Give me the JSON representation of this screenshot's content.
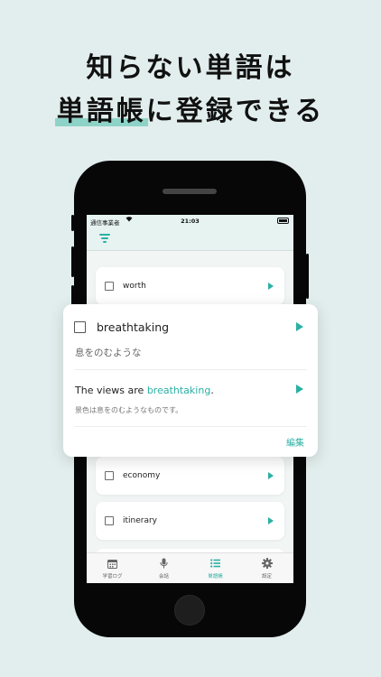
{
  "headline": {
    "line1": "知らない単語は",
    "line2_highlight": "単語帳",
    "line2_rest": "に登録できる"
  },
  "status_bar": {
    "carrier": "通信事業者",
    "wifi_icon": "wifi-icon",
    "time": "21:03",
    "battery_icon": "battery-icon"
  },
  "nav_bar": {
    "filter_icon": "filter-icon"
  },
  "words": [
    {
      "word": "worth"
    },
    {
      "word": "economy"
    },
    {
      "word": "itinerary"
    }
  ],
  "popup": {
    "word": "breathtaking",
    "meaning": "息をのむような",
    "sentence_prefix": "The views are ",
    "sentence_highlight": "breathtaking",
    "sentence_suffix": ".",
    "translation": "景色は息をのむようなものです。",
    "edit_label": "編集"
  },
  "tabs": [
    {
      "label": "学習ログ",
      "icon": "calendar-icon",
      "active": false
    },
    {
      "label": "会話",
      "icon": "microphone-icon",
      "active": false
    },
    {
      "label": "単語帳",
      "icon": "list-icon",
      "active": true
    },
    {
      "label": "設定",
      "icon": "gear-icon",
      "active": false
    }
  ],
  "colors": {
    "background": "#e2eeed",
    "accent": "#2bb0a3",
    "highlight_bar": "#8ed3c7"
  }
}
